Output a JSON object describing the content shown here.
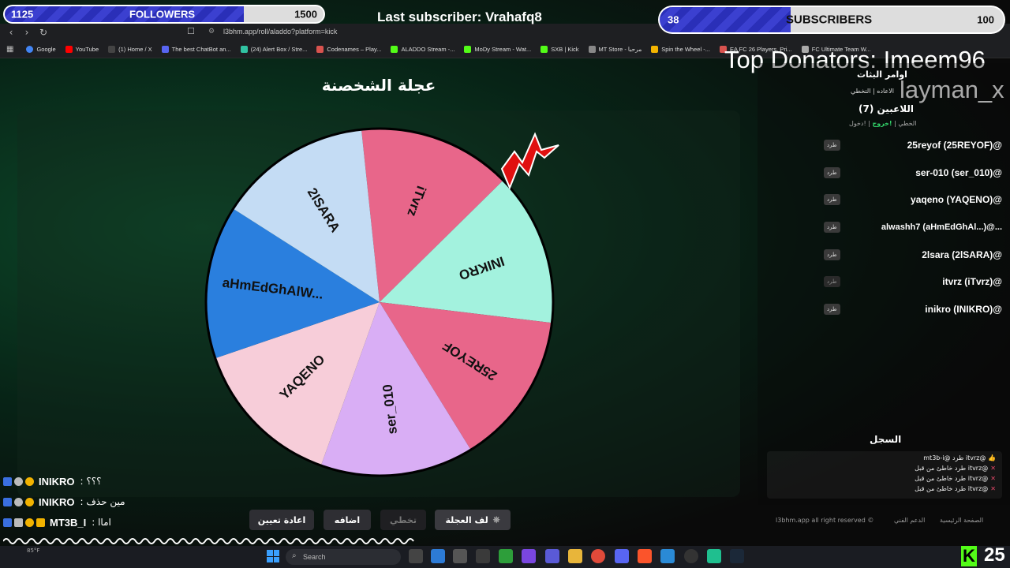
{
  "overlay": {
    "followers": {
      "current": "1125",
      "label": "FOLLOWERS",
      "goal": "1500",
      "progress": 0.75
    },
    "subscribers": {
      "current": "38",
      "label": "SUBSCRIBERS",
      "goal": "100",
      "progress": 0.38
    },
    "last_subscriber": "Last subscriber: Vrahafq8",
    "top_donators_line1": "Top Donators: Imeem96",
    "top_donators_line2": "layman_x"
  },
  "browser": {
    "url": "l3bhm.app/roll/aladdo?platform=kick",
    "bookmarks": [
      {
        "label": "Google",
        "color": "#4285f4"
      },
      {
        "label": "YouTube",
        "color": "#ff0000"
      },
      {
        "label": "(1) Home / X",
        "color": "#000000"
      },
      {
        "label": "The best ChatBot an...",
        "color": "#5865f2"
      },
      {
        "label": "(24) Alert Box / Stre...",
        "color": "#31c3a2"
      },
      {
        "label": "Codenames – Play...",
        "color": "#d9534f"
      },
      {
        "label": "ALADDO Stream -...",
        "color": "#53fc18"
      },
      {
        "label": "MoDy Stream - Wat...",
        "color": "#53fc18"
      },
      {
        "label": "SXB | Kick",
        "color": "#53fc18"
      },
      {
        "label": "MT Store - مرحبا",
        "color": "#888888"
      },
      {
        "label": "Spin the Wheel -...",
        "color": "#f4b400"
      },
      {
        "label": "EA FC 26 Players, Pri...",
        "color": "#d9534f"
      },
      {
        "label": "FC Ultimate Team W...",
        "color": "#aaaaaa"
      }
    ]
  },
  "app": {
    "title": "عجلة الشخصنة",
    "wheel_segments": [
      {
        "label": "iTvrz",
        "color": "#e8668a"
      },
      {
        "label": "INIKRO",
        "color": "#a3f2de"
      },
      {
        "label": "25REYOF",
        "color": "#e8668a"
      },
      {
        "label": "ser_010",
        "color": "#d9aef5"
      },
      {
        "label": "YAQENO",
        "color": "#f7cdd9"
      },
      {
        "label": "aHmEdGhAlW...",
        "color": "#2a7fde"
      },
      {
        "label": "2ISARA",
        "color": "#c4dcf4"
      }
    ],
    "sidebar": {
      "commands_title": "اوامر البثات",
      "commands_row": "الاعاده | التخطي",
      "players_title": "اللاعبين (7)",
      "legend_join": "!دخول",
      "legend_exit": "!خروج",
      "legend_skip": "الخطي",
      "kick_label": "طرد",
      "players": [
        "25reyof (25REYOF)@",
        "ser-010 (ser_010)@",
        "yaqeno (YAQENO)@",
        "alwashh7 (aHmEdGhAl...)@...",
        "2lsara (2lSARA)@",
        "itvrz (iTvrz)@",
        "inikro (INIKRO)@"
      ],
      "log_title": "السجل",
      "log": [
        "mt3b-i@ طرد itvrz@ 👍",
        "طرد خاطئ من قبل itvrz@",
        "طرد خاطئ من قبل itvrz@",
        "طرد خاطئ من قبل itvrz@"
      ]
    },
    "buttons": {
      "spin": "لف العجلة",
      "skip": "تخطي",
      "add": "اضافه",
      "reset": "اعادة تعيين"
    },
    "footer": {
      "copyright": "l3bhm.app all right reserved ©",
      "support": "الدعم الفني",
      "home": "الصفحة الرئيسية"
    }
  },
  "chat": [
    {
      "name": "INIKRO",
      "message": ": ؟؟؟"
    },
    {
      "name": "INIKRO",
      "message": ": مين حذف"
    },
    {
      "name": "MT3B_I",
      "message": ": اماا"
    }
  ],
  "taskbar": {
    "search_placeholder": "Search",
    "weather": "85°F",
    "counter": "25"
  }
}
